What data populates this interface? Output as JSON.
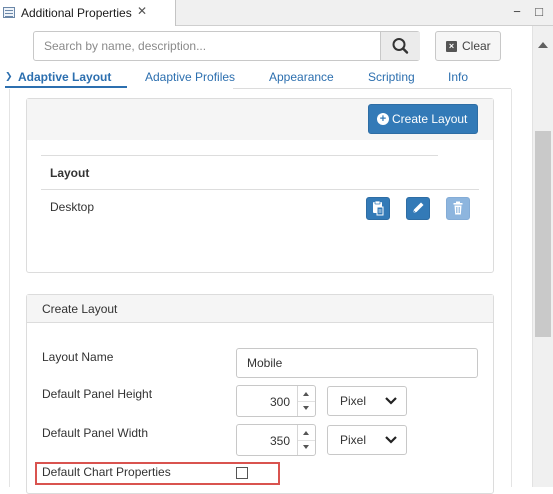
{
  "view": {
    "title": "Additional Properties",
    "close_glyph": "✕",
    "minimize_glyph": "−",
    "maximize_glyph": "□"
  },
  "search": {
    "placeholder": "Search by name, description...",
    "value": "",
    "icon": "search-icon",
    "clear_label": "Clear",
    "clear_icon": "close-icon"
  },
  "tabs": [
    {
      "label": "Adaptive Layout",
      "active": true
    },
    {
      "label": "Adaptive Profiles",
      "active": false
    },
    {
      "label": "Appearance",
      "active": false
    },
    {
      "label": "Scripting",
      "active": false
    },
    {
      "label": "Info",
      "active": false
    }
  ],
  "layouts_panel": {
    "create_button": "Create Layout",
    "create_icon": "plus-circle-icon",
    "column_header": "Layout",
    "rows": [
      {
        "name": "Desktop",
        "actions": [
          "copy-icon",
          "edit-icon",
          "delete-icon"
        ],
        "delete_disabled": true
      }
    ]
  },
  "create_panel": {
    "title": "Create Layout",
    "layout_name_label": "Layout Name",
    "layout_name_value": "Mobile",
    "panel_height_label": "Default Panel Height",
    "panel_height_value": "300",
    "panel_height_unit": "Pixel",
    "panel_width_label": "Default Panel Width",
    "panel_width_value": "350",
    "panel_width_unit": "Pixel",
    "chart_props_label": "Default Chart Properties",
    "chart_props_checked": false
  },
  "colors": {
    "primary": "#337ab7",
    "tab_text": "#2c6faf",
    "highlight_border": "#d9534f"
  }
}
